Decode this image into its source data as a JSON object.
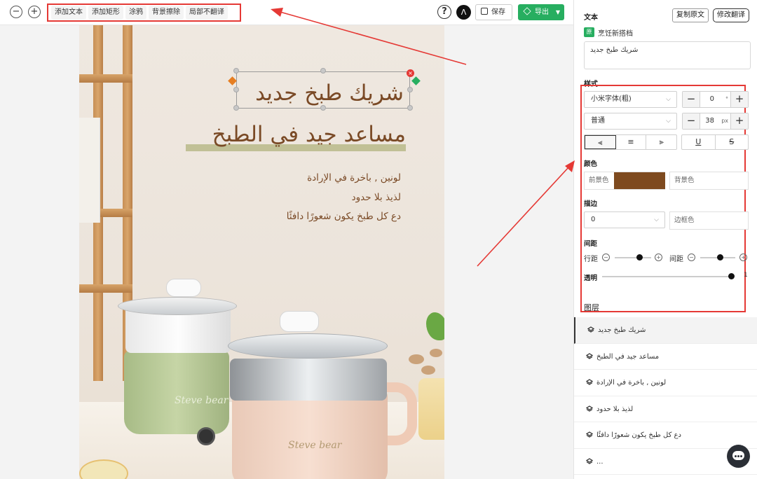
{
  "toolbar": {
    "zoom_out": "−",
    "zoom_in": "+",
    "tools": [
      "添加文本",
      "添加矩形",
      "涂鸦",
      "背景擦除",
      "局部不翻译"
    ],
    "help_icon": "?",
    "save_label": "保存",
    "export_label": "导出"
  },
  "canvas": {
    "title1": "شريك طبخ جديد",
    "title2": "مساعد جيد في الطبخ",
    "line1": "لونين , باخرة في الإرادة",
    "line2": "لذيذ بلا حدود",
    "line3": "دع كل طبخ يكون شعورًا دافئًا",
    "brand1": "Steve bear",
    "brand2": "Steve bear"
  },
  "panel": {
    "text_heading": "文本",
    "copy_original": "复制原文",
    "edit_translation": "修改翻译",
    "original_badge": "原",
    "original_text": "烹饪新搭档",
    "translated_text": "شريك طبخ جديد",
    "style_heading": "样式",
    "font_family": "小米字体(粗)",
    "rotation_value": "0",
    "rotation_unit": "°",
    "font_weight": "普通",
    "font_size_value": "38",
    "font_size_unit": "px",
    "color_heading": "颜色",
    "foreground_label": "前景色",
    "background_label": "背景色",
    "stroke_heading": "描边",
    "stroke_value": "0",
    "border_color_label": "边框色",
    "spacing_heading": "间距",
    "line_spacing_label": "行距",
    "letter_spacing_label": "间距",
    "opacity_label": "透明",
    "opacity_value": "1",
    "layers_heading": "图层",
    "layers": [
      "شريك طبخ جديد",
      "مساعد جيد في الطبخ",
      "لونين , باخرة في الإرادة",
      "لذيذ بلا حدود",
      "دع كل طبخ يكون شعورًا دافئًا",
      "..."
    ]
  },
  "colors": {
    "accent_green": "#27ae60",
    "annotation_red": "#e53935",
    "text_brown": "#7a4a26",
    "foreground_swatch": "#7e4a1f"
  }
}
